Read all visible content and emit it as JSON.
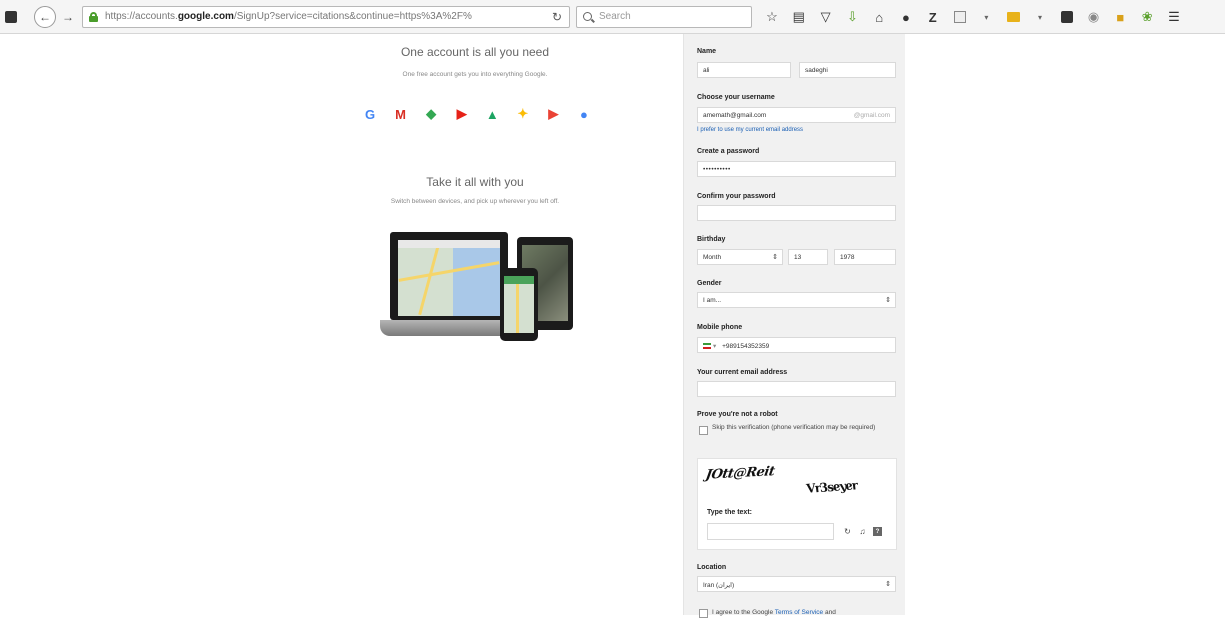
{
  "browser": {
    "url_prefix": "https://accounts.",
    "url_domain": "google.com",
    "url_path": "/SignUp?service=citations&continue=https%3A%2F%",
    "search_placeholder": "Search",
    "toolbar_icons": [
      "star-icon",
      "reading-list-icon",
      "pocket-icon",
      "download-icon",
      "home-icon",
      "chat-icon",
      "zotero-icon",
      "screenshot-icon",
      "dropdown-icon",
      "folder-icon",
      "dropdown-icon",
      "black-square-icon",
      "addon-circle-icon",
      "bookmark-icon",
      "addon-green-icon",
      "menu-icon"
    ]
  },
  "promo": {
    "heading": "One account is all you need",
    "subheading": "One free account gets you into everything Google.",
    "heading2": "Take it all with you",
    "subheading2": "Switch between devices, and pick up wherever you left off.",
    "services": [
      {
        "name": "google-icon",
        "glyph": "G",
        "color": "#4285f4"
      },
      {
        "name": "gmail-icon",
        "glyph": "M",
        "color": "#d93025"
      },
      {
        "name": "maps-icon",
        "glyph": "◆",
        "color": "#34a853"
      },
      {
        "name": "youtube-icon",
        "glyph": "▶",
        "color": "#e62117"
      },
      {
        "name": "drive-icon",
        "glyph": "▲",
        "color": "#1da462"
      },
      {
        "name": "photos-icon",
        "glyph": "✦",
        "color": "#fbbc05"
      },
      {
        "name": "play-icon",
        "glyph": "▶",
        "color": "#ea4335"
      },
      {
        "name": "chrome-icon",
        "glyph": "●",
        "color": "#4285f4"
      }
    ]
  },
  "form": {
    "name_label": "Name",
    "first_name": "ali",
    "last_name": "sadeghi",
    "username_label": "Choose your username",
    "username_value": "amemath@gmail.com",
    "username_suffix": "@gmail.com",
    "prefer_link": "I prefer to use my current email address",
    "password_label": "Create a password",
    "password_value": "••••••••••",
    "confirm_label": "Confirm your password",
    "birthday_label": "Birthday",
    "birth_month": "Month",
    "birth_day": "13",
    "birth_year": "1978",
    "gender_label": "Gender",
    "gender_value": "I am...",
    "phone_label": "Mobile phone",
    "phone_value": "+989154352359",
    "current_email_label": "Your current email address",
    "robot_label": "Prove you're not a robot",
    "skip_text": "Skip this verification (phone verification may be required)",
    "captcha_word1": "JOtt@Reit",
    "captcha_word2": "Vr3seyer",
    "type_text_label": "Type the text:",
    "location_label": "Location",
    "location_value": "Iran (ایران)",
    "agree_prefix": "I agree to the Google ",
    "agree_link": "Terms of Service",
    "agree_suffix": " and"
  }
}
